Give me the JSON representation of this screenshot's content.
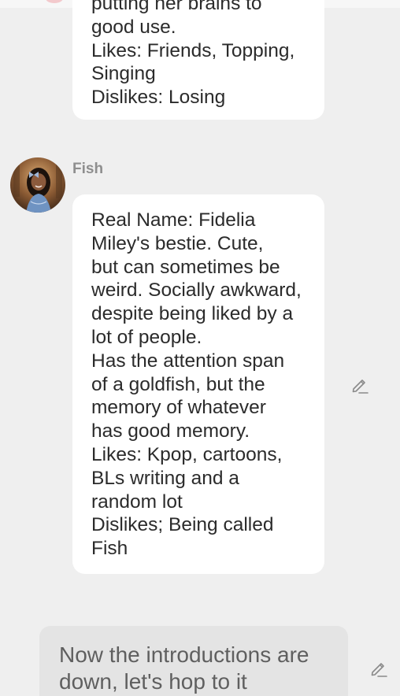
{
  "previous_message": {
    "text": "putting her brains to\ngood use.\nLikes: Friends, Topping,\nSinging\nDislikes: Losing"
  },
  "fish_message": {
    "sender": "Fish",
    "avatar_icon": "character-portrait-avatar",
    "text": "Real Name: Fidelia\nMiley's bestie. Cute,\nbut can sometimes be\nweird. Socially awkward,\ndespite being liked by a\nlot of people.\nHas the attention span\nof a goldfish, but the\nmemory of whatever\nhas good memory.\nLikes: Kpop, cartoons,\nBLs writing and a\nrandom lot\nDislikes; Being called\nFish",
    "edit_icon": "pencil-icon"
  },
  "user_message": {
    "text": "Now the introductions are\ndown, let's hop to it",
    "edit_icon": "pencil-icon"
  },
  "colors": {
    "background": "#efefef",
    "bubble": "#ffffff",
    "user_bubble": "#e4e4e4",
    "name_gray": "#8e8e8e"
  }
}
